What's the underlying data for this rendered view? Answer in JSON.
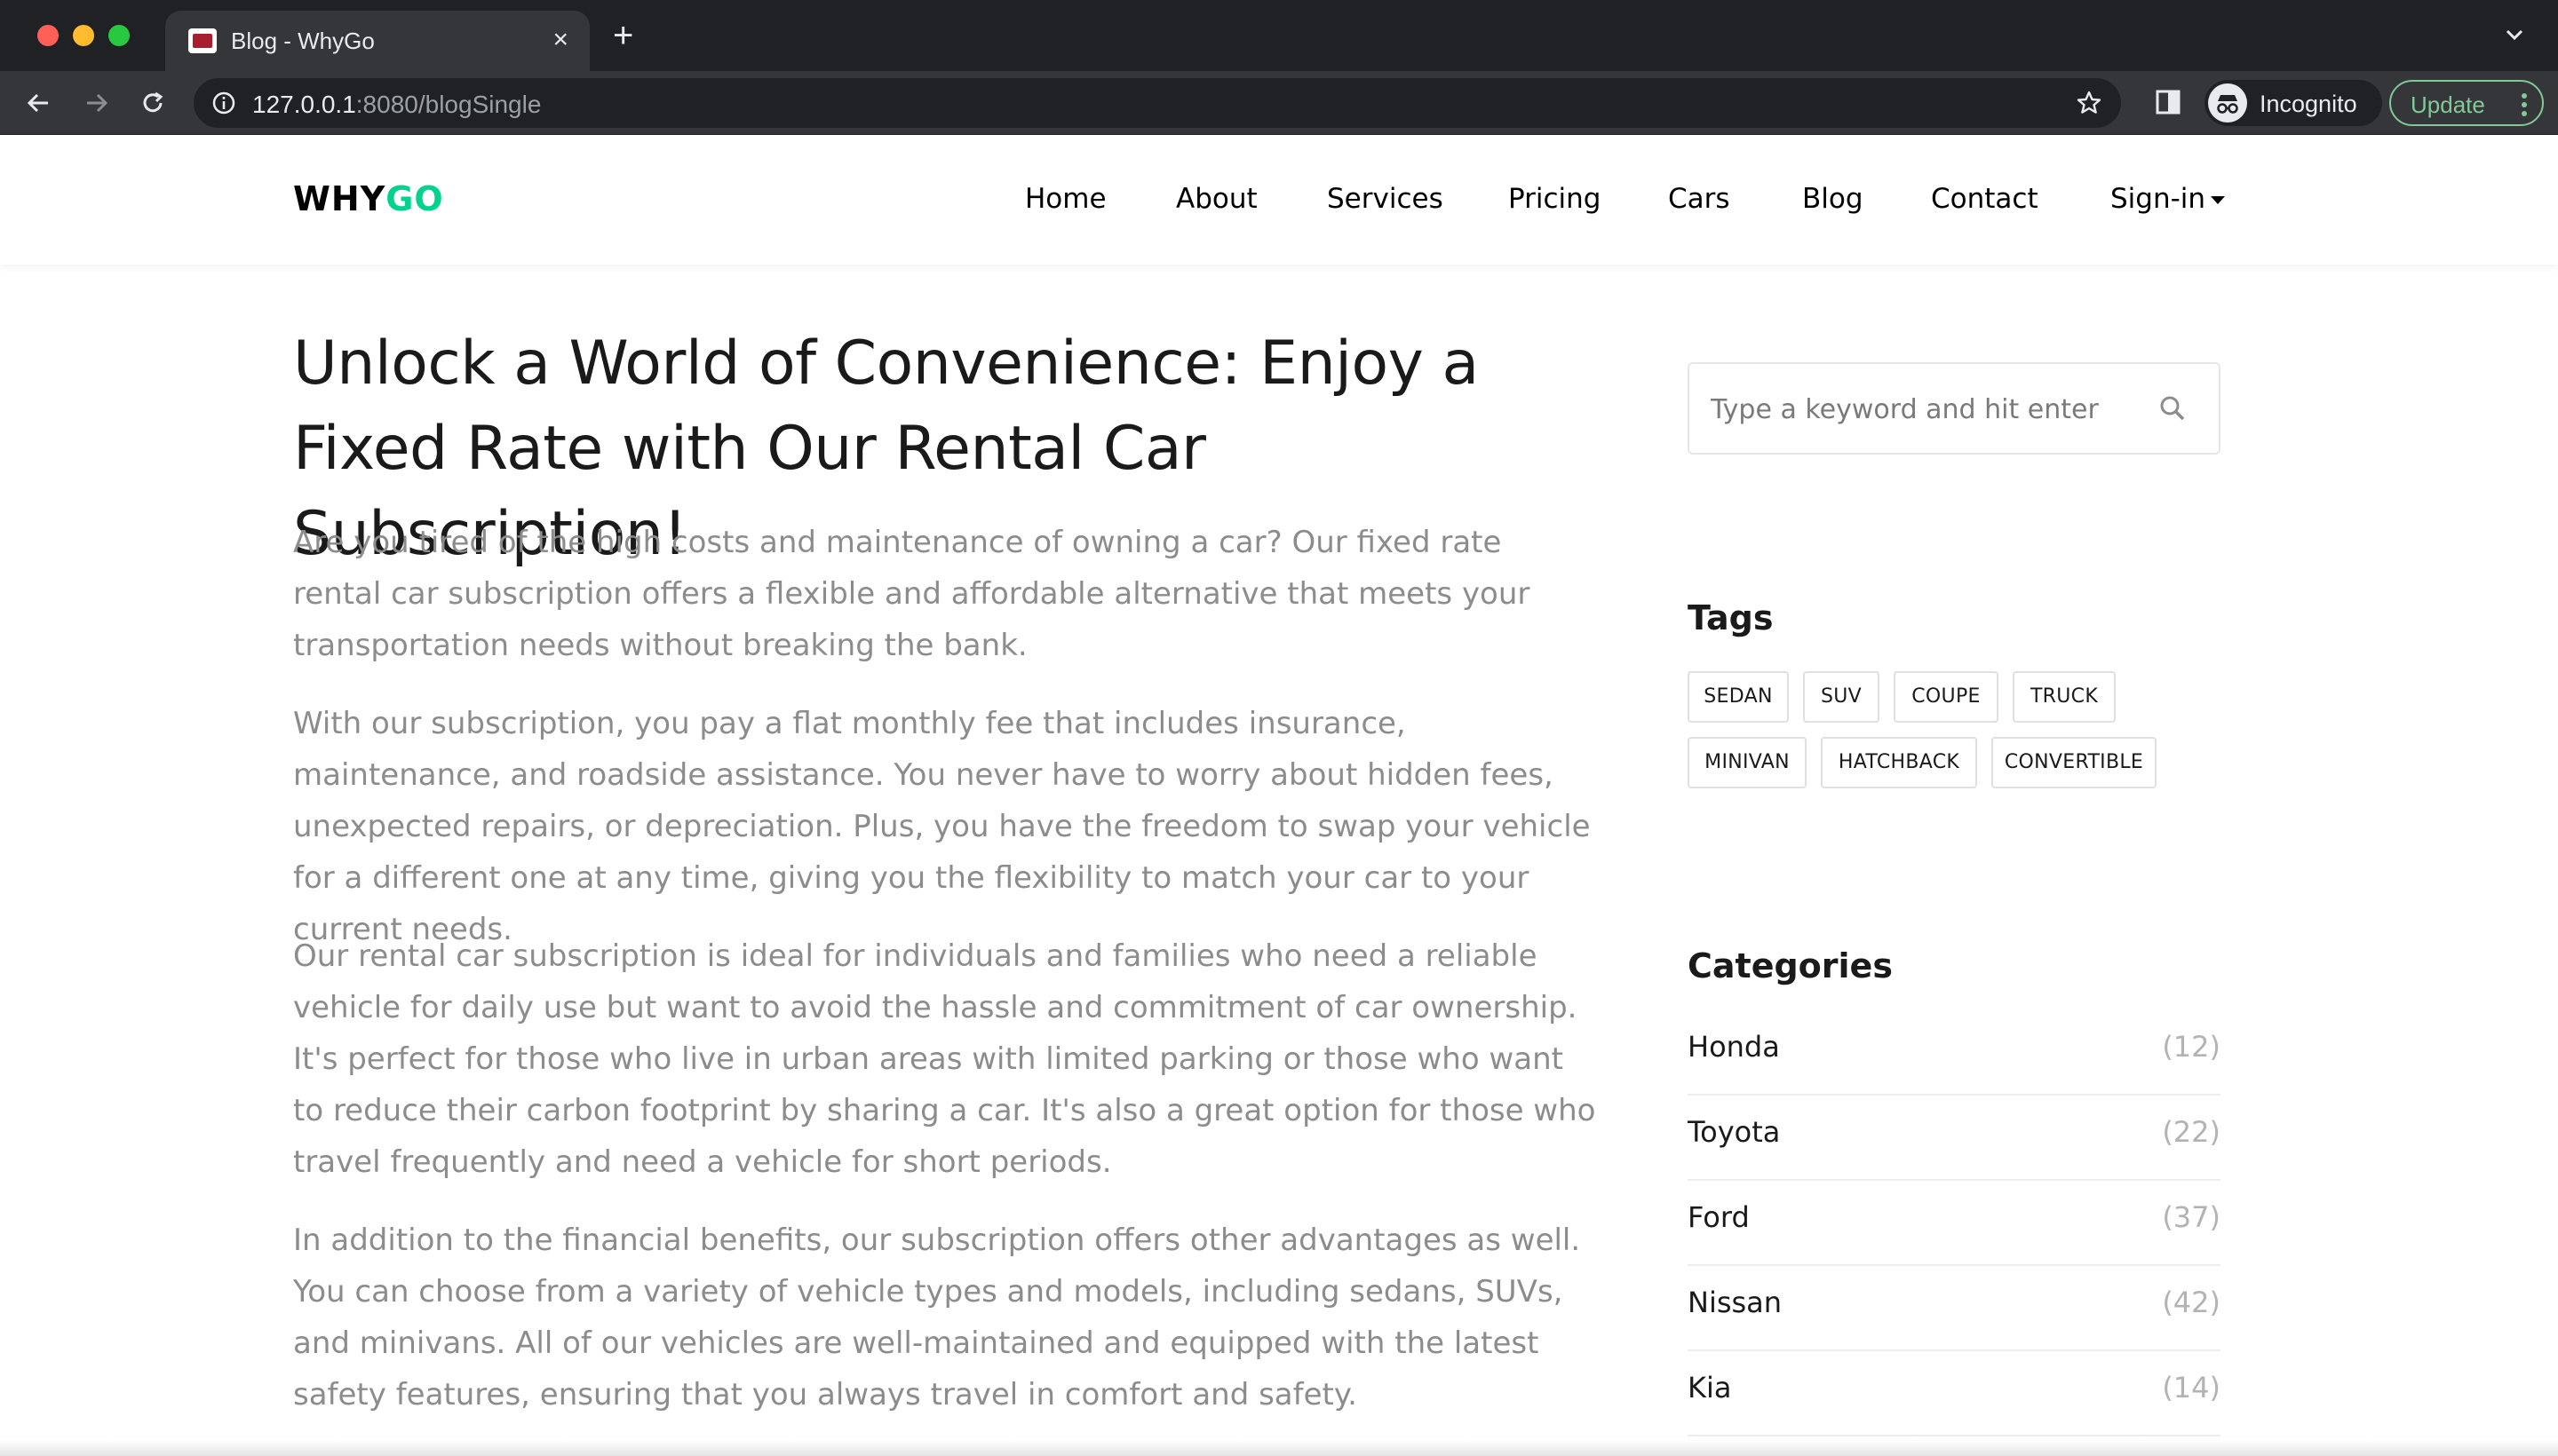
{
  "browser": {
    "tab_title": "Blog - WhyGo",
    "url_host": "127.0.0.1",
    "url_rest": ":8080/blogSingle",
    "profile_label": "Incognito",
    "update_label": "Update"
  },
  "site": {
    "logo_part1": "WHY",
    "logo_part2": "GO",
    "nav": {
      "home": "Home",
      "about": "About",
      "services": "Services",
      "pricing": "Pricing",
      "cars": "Cars",
      "blog": "Blog",
      "contact": "Contact",
      "signin": "Sign-in"
    }
  },
  "post": {
    "title": "Unlock a World of Convenience: Enjoy a Fixed Rate with Our Rental Car Subscription!",
    "paragraphs": [
      "Are you tired of the high costs and maintenance of owning a car? Our fixed rate rental car subscription offers a flexible and affordable alternative that meets your transportation needs without breaking the bank.",
      "With our subscription, you pay a flat monthly fee that includes insurance, maintenance, and roadside assistance. You never have to worry about hidden fees, unexpected repairs, or depreciation. Plus, you have the freedom to swap your vehicle for a different one at any time, giving you the flexibility to match your car to your current needs.",
      "Our rental car subscription is ideal for individuals and families who need a reliable vehicle for daily use but want to avoid the hassle and commitment of car ownership. It's perfect for those who live in urban areas with limited parking or those who want to reduce their carbon footprint by sharing a car. It's also a great option for those who travel frequently and need a vehicle for short periods.",
      "In addition to the financial benefits, our subscription offers other advantages as well. You can choose from a variety of vehicle types and models, including sedans, SUVs, and minivans. All of our vehicles are well-maintained and equipped with the latest safety features, ensuring that you always travel in comfort and safety."
    ]
  },
  "sidebar": {
    "search_placeholder": "Type a keyword and hit enter",
    "tags_heading": "Tags",
    "tags": [
      "SEDAN",
      "SUV",
      "COUPE",
      "TRUCK",
      "MINIVAN",
      "HATCHBACK",
      "CONVERTIBLE"
    ],
    "categories_heading": "Categories",
    "categories": [
      {
        "name": "Honda",
        "count": "(12)"
      },
      {
        "name": "Toyota",
        "count": "(22)"
      },
      {
        "name": "Ford",
        "count": "(37)"
      },
      {
        "name": "Nissan",
        "count": "(42)"
      },
      {
        "name": "Kia",
        "count": "(14)"
      }
    ]
  },
  "colors": {
    "brand_green": "#01d28e",
    "text_dark": "#1a1a1a",
    "text_muted": "#8c8c8c"
  }
}
